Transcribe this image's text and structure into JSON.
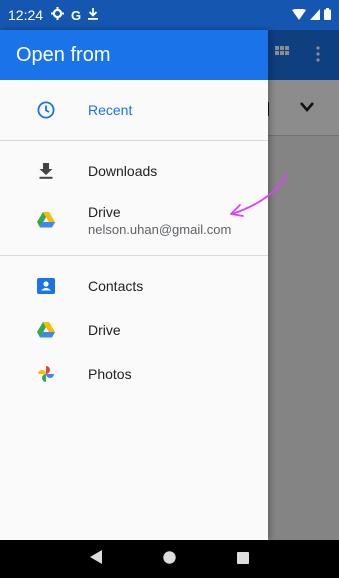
{
  "status_bar": {
    "time": "12:24",
    "icons": [
      "gear-icon",
      "google-g-icon",
      "download-icon"
    ]
  },
  "drawer": {
    "title": "Open from",
    "sections": [
      {
        "items": [
          {
            "label": "Recent",
            "icon": "clock-icon",
            "active": true
          }
        ]
      },
      {
        "items": [
          {
            "label": "Downloads",
            "icon": "download-icon"
          },
          {
            "label": "Drive",
            "sublabel": "nelson.uhan@gmail.com",
            "icon": "drive-icon"
          }
        ]
      },
      {
        "items": [
          {
            "label": "Contacts",
            "icon": "contacts-icon"
          },
          {
            "label": "Drive",
            "icon": "drive-icon"
          },
          {
            "label": "Photos",
            "icon": "photos-icon"
          }
        ]
      }
    ]
  },
  "colors": {
    "accent": "#1a73e8",
    "status_bar": "#1557b0",
    "annotation": "#e040fb"
  },
  "nav_bar": {
    "buttons": [
      "back-icon",
      "home-icon",
      "recents-icon"
    ]
  }
}
